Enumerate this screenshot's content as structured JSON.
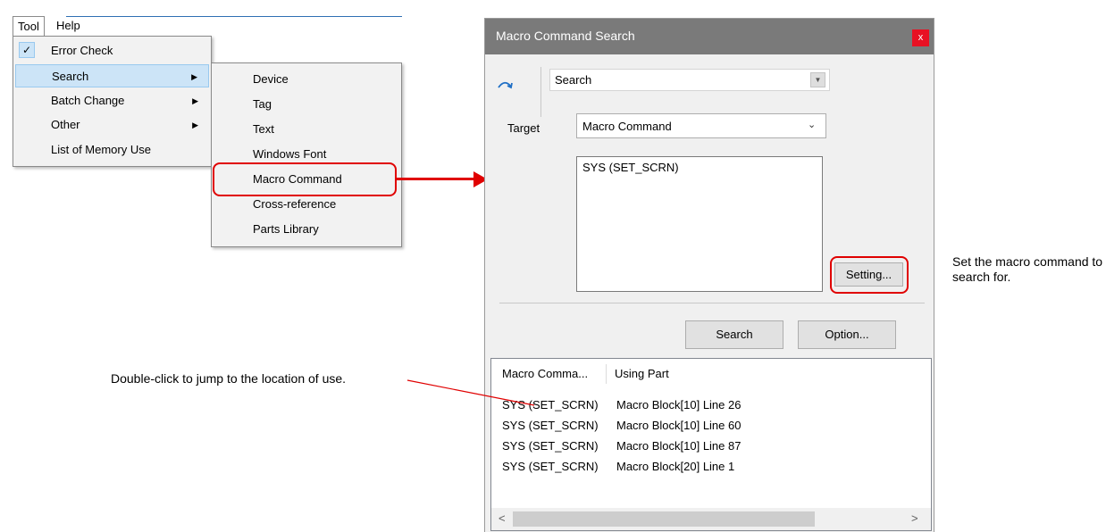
{
  "menubar": {
    "tool": "Tool",
    "help": "Help"
  },
  "tool_menu": {
    "items": [
      {
        "label": "Error Check",
        "checked": true,
        "submenu": false
      },
      {
        "label": "Search",
        "checked": false,
        "submenu": true,
        "highlighted": true
      },
      {
        "label": "Batch Change",
        "checked": false,
        "submenu": true
      },
      {
        "label": "Other",
        "checked": false,
        "submenu": true
      },
      {
        "label": "List of Memory Use",
        "checked": false,
        "submenu": false
      }
    ],
    "check_glyph": "✓",
    "arrow_glyph": "▶"
  },
  "search_submenu": {
    "items": [
      "Device",
      "Tag",
      "Text",
      "Windows Font",
      "Macro Command",
      "Cross-reference",
      "Parts Library"
    ],
    "highlighted_item": "Macro Command"
  },
  "dialog": {
    "title": "Macro Command Search",
    "close_glyph": "x",
    "search_combo_value": "Search",
    "target_label": "Target",
    "target_value": "Macro Command",
    "macro_list": [
      "SYS (SET_SCRN)"
    ],
    "setting_button": "Setting...",
    "search_button": "Search",
    "option_button": "Option...",
    "results": {
      "columns": [
        "Macro Comma...",
        "Using Part"
      ],
      "rows": [
        [
          "SYS (SET_SCRN)",
          "Macro Block[10] Line 26"
        ],
        [
          "SYS (SET_SCRN)",
          "Macro Block[10] Line 60"
        ],
        [
          "SYS (SET_SCRN)",
          "Macro Block[10] Line 87"
        ],
        [
          "SYS (SET_SCRN)",
          "Macro Block[20] Line 1"
        ]
      ]
    },
    "scroll_left": "<",
    "scroll_right": ">"
  },
  "annotations": {
    "setting_note": "Set the macro command to search for.",
    "dblclick_note": "Double-click to jump to the location of use."
  },
  "colors": {
    "callout": "#e00000",
    "menu_highlight": "#cce4f7",
    "titlebar": "#7a7a7a",
    "close_button": "#e81123"
  }
}
